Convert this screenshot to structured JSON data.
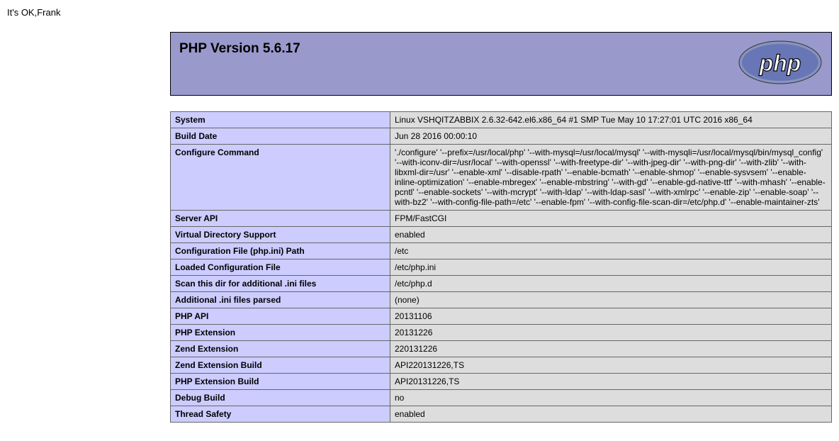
{
  "page_text": "It's OK,Frank",
  "header": {
    "title": "PHP Version 5.6.17"
  },
  "rows": [
    {
      "key": "System",
      "value": "Linux VSHQITZABBIX 2.6.32-642.el6.x86_64 #1 SMP Tue May 10 17:27:01 UTC 2016 x86_64"
    },
    {
      "key": "Build Date",
      "value": "Jun 28 2016 00:00:10"
    },
    {
      "key": "Configure Command",
      "value": "'./configure' '--prefix=/usr/local/php' '--with-mysql=/usr/local/mysql' '--with-mysqli=/usr/local/mysql/bin/mysql_config' '--with-iconv-dir=/usr/local' '--with-openssl' '--with-freetype-dir' '--with-jpeg-dir' '--with-png-dir' '--with-zlib' '--with-libxml-dir=/usr' '--enable-xml' '--disable-rpath' '--enable-bcmath' '--enable-shmop' '--enable-sysvsem' '--enable-inline-optimization' '--enable-mbregex' '--enable-mbstring' '--with-gd' '--enable-gd-native-ttf' '--with-mhash' '--enable-pcntl' '--enable-sockets' '--with-mcrypt' '--with-ldap' '--with-ldap-sasl' '--with-xmlrpc' '--enable-zip' '--enable-soap' '--with-bz2' '--with-config-file-path=/etc' '--enable-fpm' '--with-config-file-scan-dir=/etc/php.d' '--enable-maintainer-zts'"
    },
    {
      "key": "Server API",
      "value": "FPM/FastCGI"
    },
    {
      "key": "Virtual Directory Support",
      "value": "enabled"
    },
    {
      "key": "Configuration File (php.ini) Path",
      "value": "/etc"
    },
    {
      "key": "Loaded Configuration File",
      "value": "/etc/php.ini"
    },
    {
      "key": "Scan this dir for additional .ini files",
      "value": "/etc/php.d"
    },
    {
      "key": "Additional .ini files parsed",
      "value": "(none)"
    },
    {
      "key": "PHP API",
      "value": "20131106"
    },
    {
      "key": "PHP Extension",
      "value": "20131226"
    },
    {
      "key": "Zend Extension",
      "value": "220131226"
    },
    {
      "key": "Zend Extension Build",
      "value": "API220131226,TS"
    },
    {
      "key": "PHP Extension Build",
      "value": "API20131226,TS"
    },
    {
      "key": "Debug Build",
      "value": "no"
    },
    {
      "key": "Thread Safety",
      "value": "enabled"
    }
  ]
}
